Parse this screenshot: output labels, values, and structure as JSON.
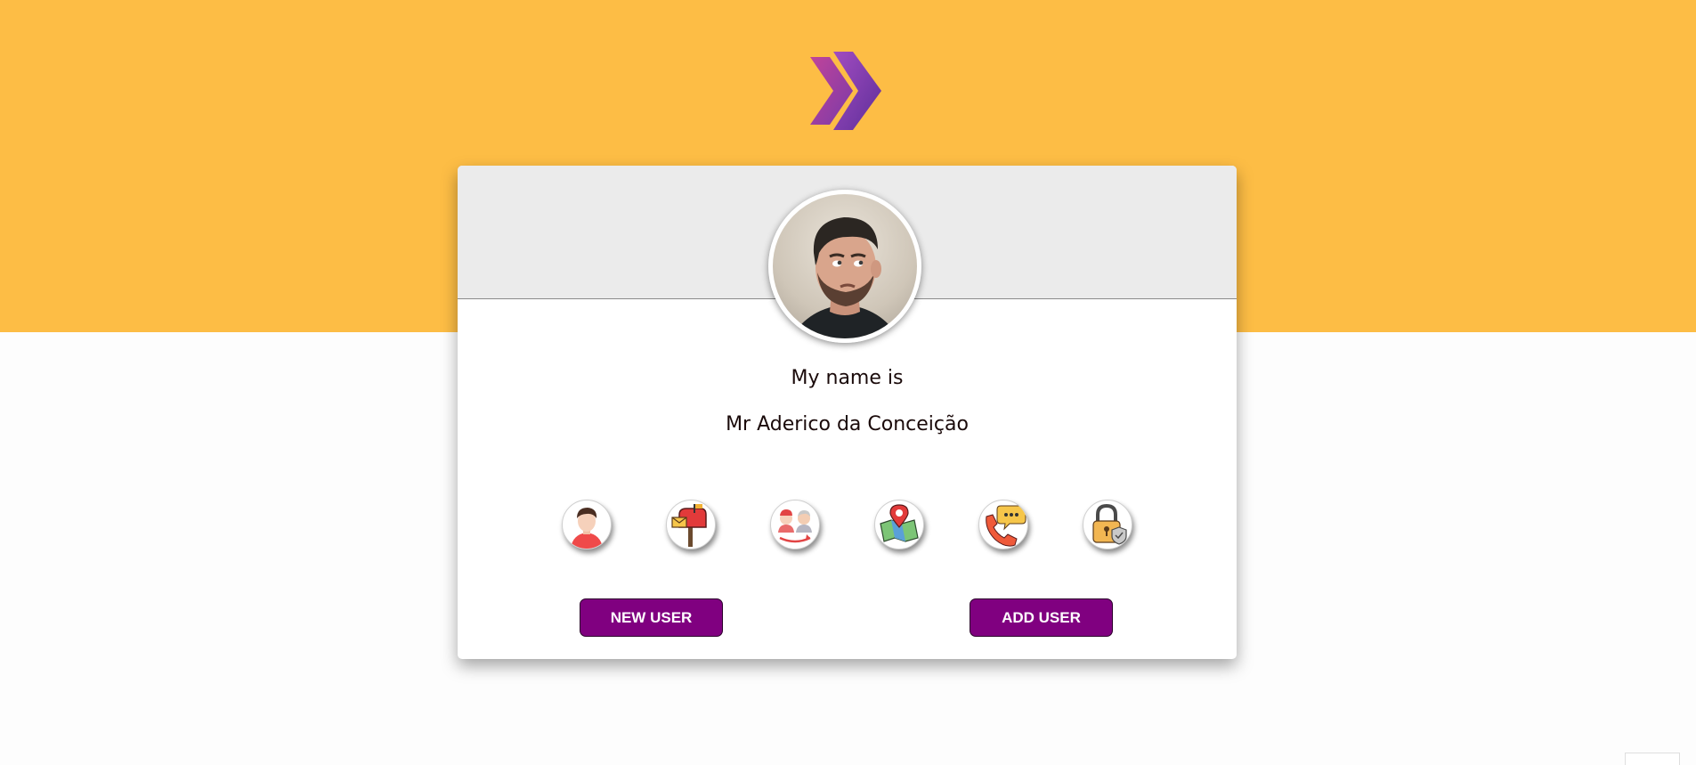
{
  "header": {
    "logo_icon": "double-chevron-logo-icon",
    "band_color": "#fdbd45"
  },
  "profile": {
    "avatar_icon": "user-photo-avatar",
    "label": "My name is",
    "value": "Mr Aderico da Conceição"
  },
  "info_icons": [
    {
      "name": "name-icon"
    },
    {
      "name": "mailbox-icon"
    },
    {
      "name": "age-icon"
    },
    {
      "name": "location-map-icon"
    },
    {
      "name": "phone-icon"
    },
    {
      "name": "password-lock-icon"
    }
  ],
  "actions": {
    "new_user_label": "NEW USER",
    "add_user_label": "ADD USER",
    "button_color": "#800080"
  }
}
